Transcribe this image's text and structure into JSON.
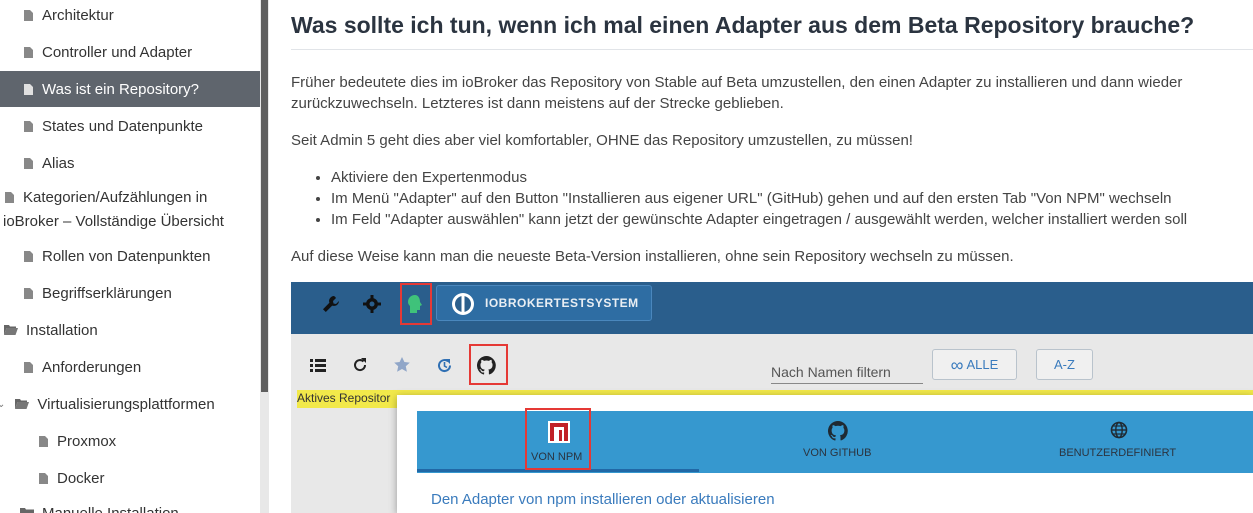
{
  "sidebar": {
    "items": [
      {
        "label": "Architektur"
      },
      {
        "label": "Controller und Adapter"
      },
      {
        "label": "Was ist ein Repository?"
      },
      {
        "label": "States und Datenpunkte"
      },
      {
        "label": "Alias"
      },
      {
        "label_line1": "Kategorien/Aufzählungen in",
        "label_line2": "ioBroker – Vollständige Übersicht"
      },
      {
        "label": "Rollen von Datenpunkten"
      },
      {
        "label": "Begriffserklärungen"
      },
      {
        "label": "Installation"
      },
      {
        "label": "Anforderungen"
      },
      {
        "label": "Virtualisierungsplattformen"
      },
      {
        "label": "Proxmox"
      },
      {
        "label": "Docker"
      },
      {
        "label": "Manuelle Installation"
      }
    ],
    "active_index": 2
  },
  "article": {
    "title": "Was sollte ich tun, wenn ich mal einen Adapter aus dem Beta Repository brauche?",
    "para1_line1": "Früher bedeutete dies im ioBroker das Repository von Stable auf Beta umzustellen, den einen Adapter zu installieren und dann wieder",
    "para1_line2": "zurückzuwechseln. Letzteres ist dann meistens auf der Strecke geblieben.",
    "para2": "Seit Admin 5 geht dies aber viel komfortabler, OHNE das Repository umzustellen, zu müssen!",
    "bullets": [
      "Aktiviere den Expertenmodus",
      "Im Menü \"Adapter\" auf den Button \"Installieren aus eigener URL\" (GitHub) gehen und auf den ersten Tab \"Von NPM\" wechseln",
      "Im Feld \"Adapter auswählen\" kann jetzt der gewünschte Adapter eingetragen / ausgewählt werden, welcher installiert werden soll"
    ],
    "para3": "Auf diese Weise kann man die neueste Beta-Version installieren, ohne sein Repository wechseln zu müssen."
  },
  "screenshot": {
    "system_name": "IOBROKERTESTSYSTEM",
    "filter_placeholder": "Nach Namen filtern",
    "btn_all": "ALLE",
    "btn_az": "A-Z",
    "repo_label": "Aktives Repositor",
    "tabs": [
      "VON NPM",
      "VON GITHUB",
      "BENUTZERDEFINIERT"
    ],
    "dialog_text": "Den Adapter von npm installieren oder aktualisieren",
    "colors": {
      "topbar": "#2a5e8c",
      "tabbar": "#3698cf",
      "highlight": "#e53935",
      "link": "#3a7bbd"
    }
  }
}
